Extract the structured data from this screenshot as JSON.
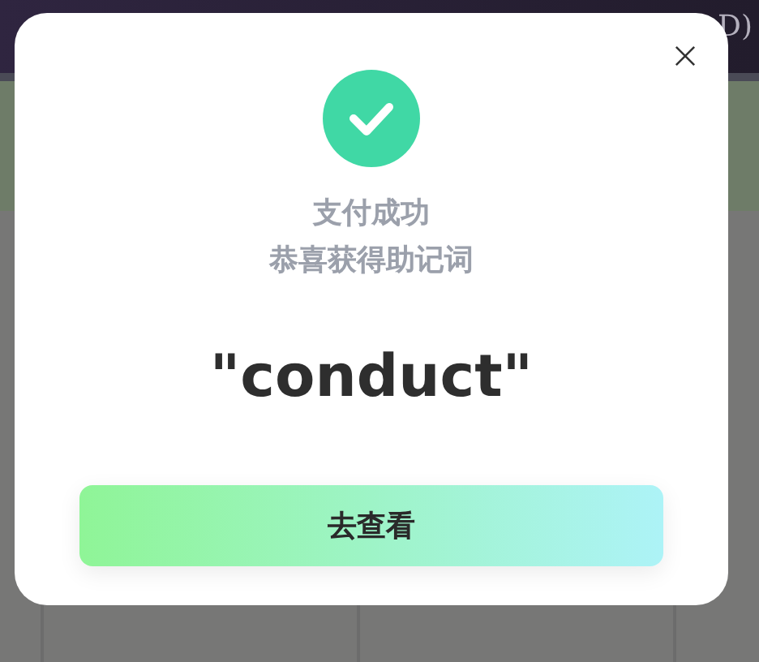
{
  "background": {
    "header_right": "D)"
  },
  "dialog": {
    "status": "支付成功",
    "message": "恭喜获得助记词",
    "word": "\"conduct\"",
    "button": "去查看"
  }
}
